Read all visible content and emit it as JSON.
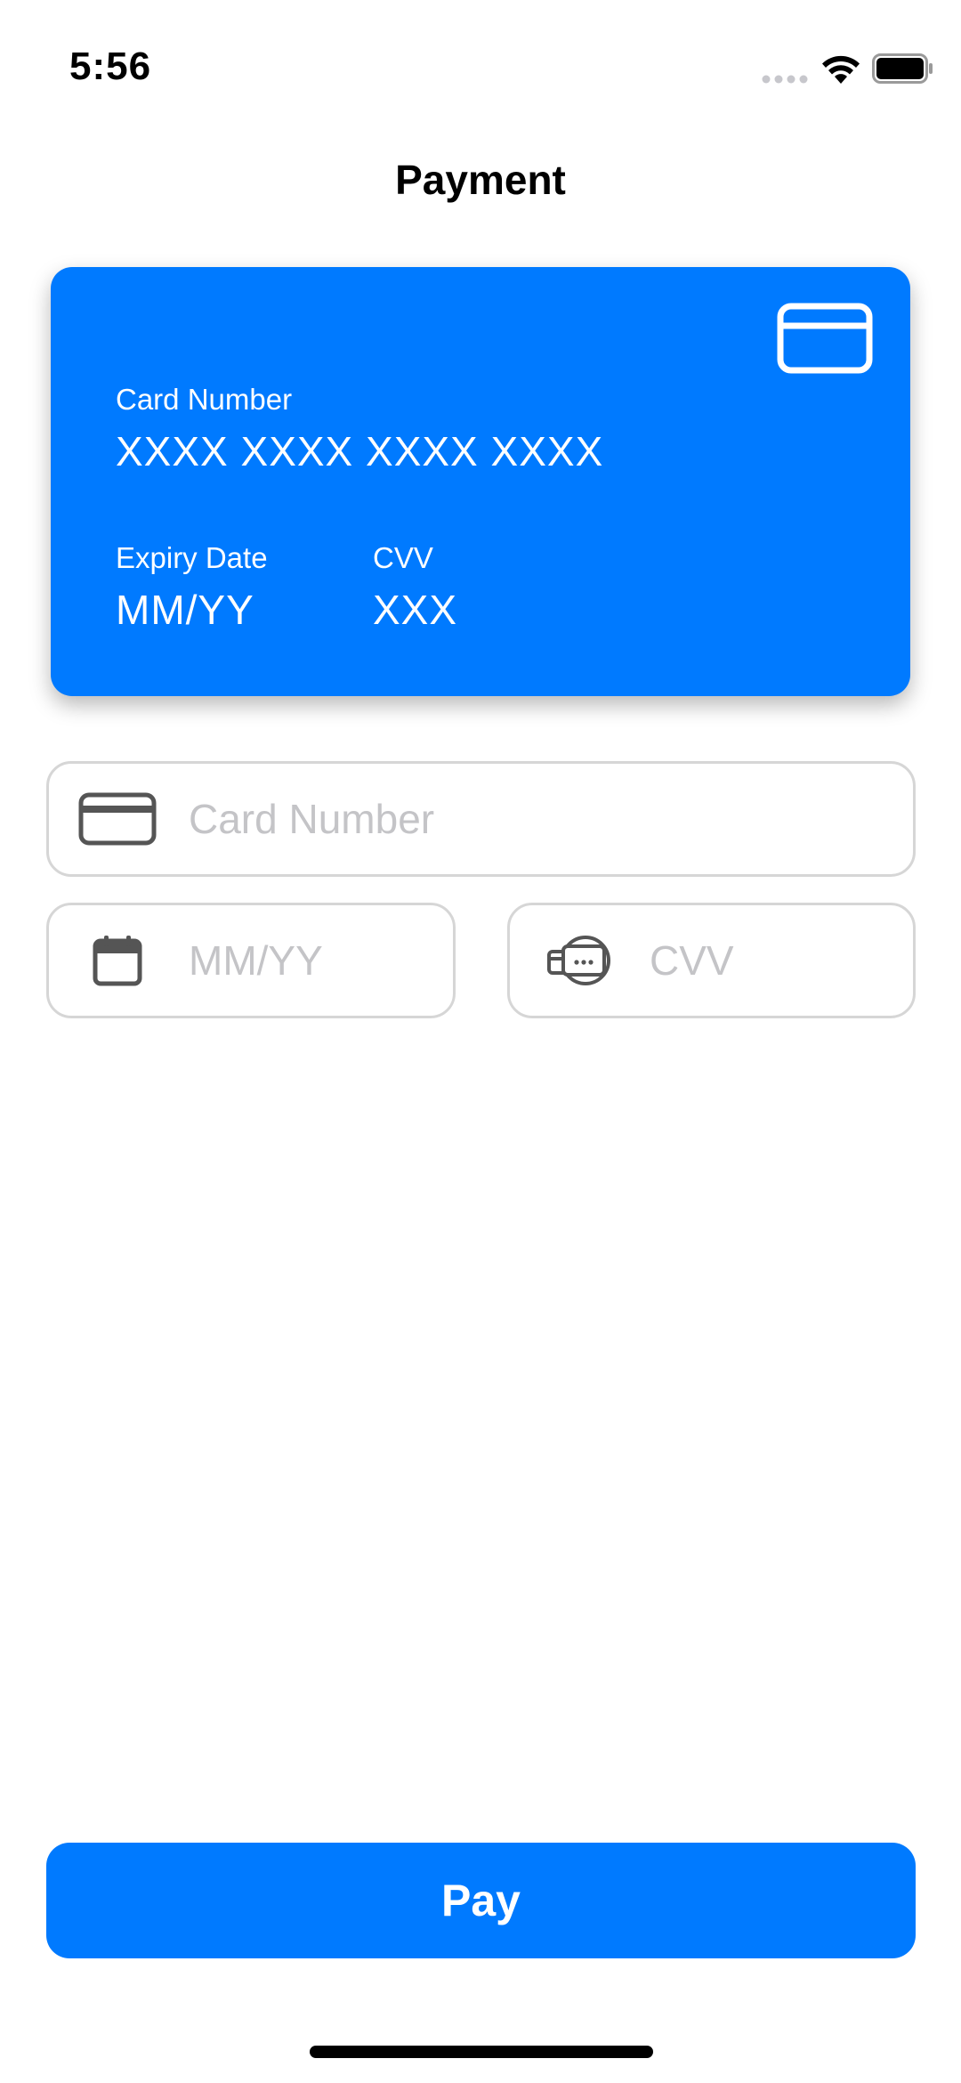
{
  "status_bar": {
    "time": "5:56"
  },
  "header": {
    "title": "Payment"
  },
  "card_preview": {
    "number_label": "Card Number",
    "number_value": "XXXX XXXX XXXX XXXX",
    "expiry_label": "Expiry Date",
    "expiry_value": "MM/YY",
    "cvv_label": "CVV",
    "cvv_value": "XXX",
    "background_color": "#007AFF",
    "icon": "credit-card-icon"
  },
  "form": {
    "card_number": {
      "placeholder": "Card Number",
      "value": "",
      "icon": "credit-card-icon"
    },
    "expiry": {
      "placeholder": "MM/YY",
      "value": "",
      "icon": "calendar-icon"
    },
    "cvv": {
      "placeholder": "CVV",
      "value": "",
      "icon": "card-security-code-icon"
    }
  },
  "actions": {
    "pay_label": "Pay",
    "accent_color": "#007AFF"
  }
}
